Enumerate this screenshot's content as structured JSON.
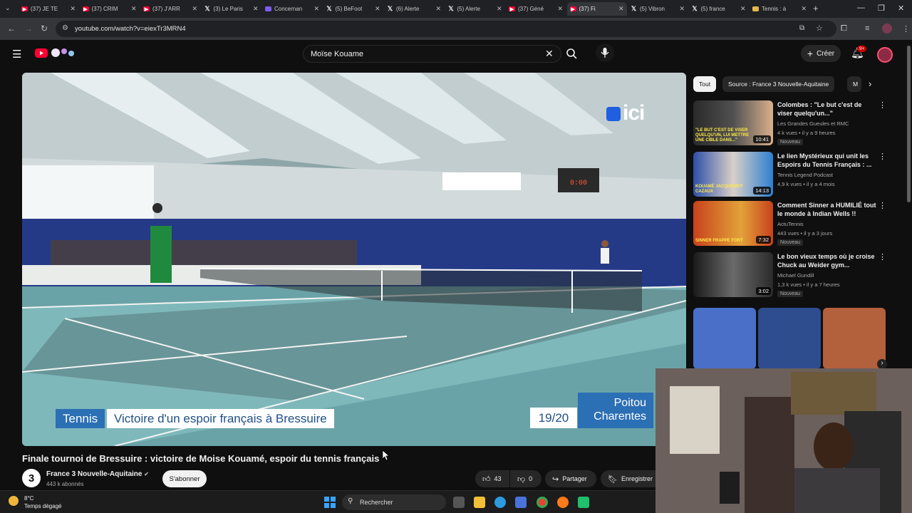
{
  "browser": {
    "tabs": [
      {
        "icon": "youtube",
        "title": "(37) JE TE"
      },
      {
        "icon": "youtube",
        "title": "(37) CRIM"
      },
      {
        "icon": "youtube",
        "title": "(37) J'ARR"
      },
      {
        "icon": "x",
        "title": "(3) Le Paris"
      },
      {
        "icon": "twitch",
        "title": "Concernan"
      },
      {
        "icon": "x",
        "title": "(5) BeFoot"
      },
      {
        "icon": "x",
        "title": "(6) Alerte"
      },
      {
        "icon": "x",
        "title": "(5) Alerte"
      },
      {
        "icon": "youtube",
        "title": "(37) Géné"
      },
      {
        "icon": "youtube",
        "title": "(37) Fi",
        "active": true
      },
      {
        "icon": "x",
        "title": "(5) Vibron"
      },
      {
        "icon": "x",
        "title": "(5) france"
      },
      {
        "icon": "generic",
        "title": "Tennis : à"
      }
    ],
    "url": "youtube.com/watch?v=eiexTr3MRN4"
  },
  "masthead": {
    "search_value": "Moïse Kouame",
    "create_label": "Créer",
    "notif_count": "9+"
  },
  "video": {
    "overlay_tag": "Tennis",
    "overlay_headline": "Victoire d'un espoir français à Bressuire",
    "overlay_time": "19/20",
    "overlay_region_line1": "Poitou",
    "overlay_region_line2": "Charentes",
    "broadcaster_logo": "ici",
    "title": "Finale tournoi de Bressuire : victoire de Moise Kouamé, espoir du tennis français",
    "channel_initial": "3",
    "channel_name": "France 3 Nouvelle-Aquitaine",
    "channel_subs": "443 k abonnés",
    "subscribe_label": "S'abonner",
    "likes": "43",
    "dislikes": "0",
    "share_label": "Partager",
    "save_label": "Enregistrer"
  },
  "chips": [
    "Tout",
    "Source : France 3 Nouvelle-Aquitaine",
    "M"
  ],
  "recommendations": [
    {
      "title": "Colombes : \"Le but c'est de viser quelqu'un...\"",
      "channel": "Les Grandes Gueules et RMC",
      "meta": "4 k vues • il y a 9 heures",
      "badge": "Nouveau",
      "duration": "10:41",
      "thumb_text": "\"LE BUT C'EST DE VISER QUELQU'UN, LUI METTRE UNE CIBLE DANS...\""
    },
    {
      "title": "Le lien Mystérieux qui unit les Espoirs du Tennis Français : ...",
      "channel": "Tennis Legend Podcast",
      "meta": "4,9 k vues • il y a 4 mois",
      "badge": "",
      "duration": "14:13",
      "thumb_text": "KOUAMÉ JACQUEMOT CAZAUX"
    },
    {
      "title": "Comment Sinner a HUMILIÉ tout le monde à Indian Wells !!",
      "channel": "ActuTennis",
      "meta": "443 vues • il y a 3 jours",
      "badge": "Nouveau",
      "duration": "7:32",
      "thumb_text": "SINNER FRAPPE FORT"
    },
    {
      "title": "Le bon vieux temps où je croise Chuck au Weider gym...",
      "channel": "Michael Gundill",
      "meta": "1,3 k vues • il y a 7 heures",
      "badge": "Nouveau",
      "duration": "3:02",
      "thumb_text": ""
    }
  ],
  "taskbar": {
    "weather_temp": "8°C",
    "weather_desc": "Temps dégagé",
    "search_label": "Rechercher"
  }
}
